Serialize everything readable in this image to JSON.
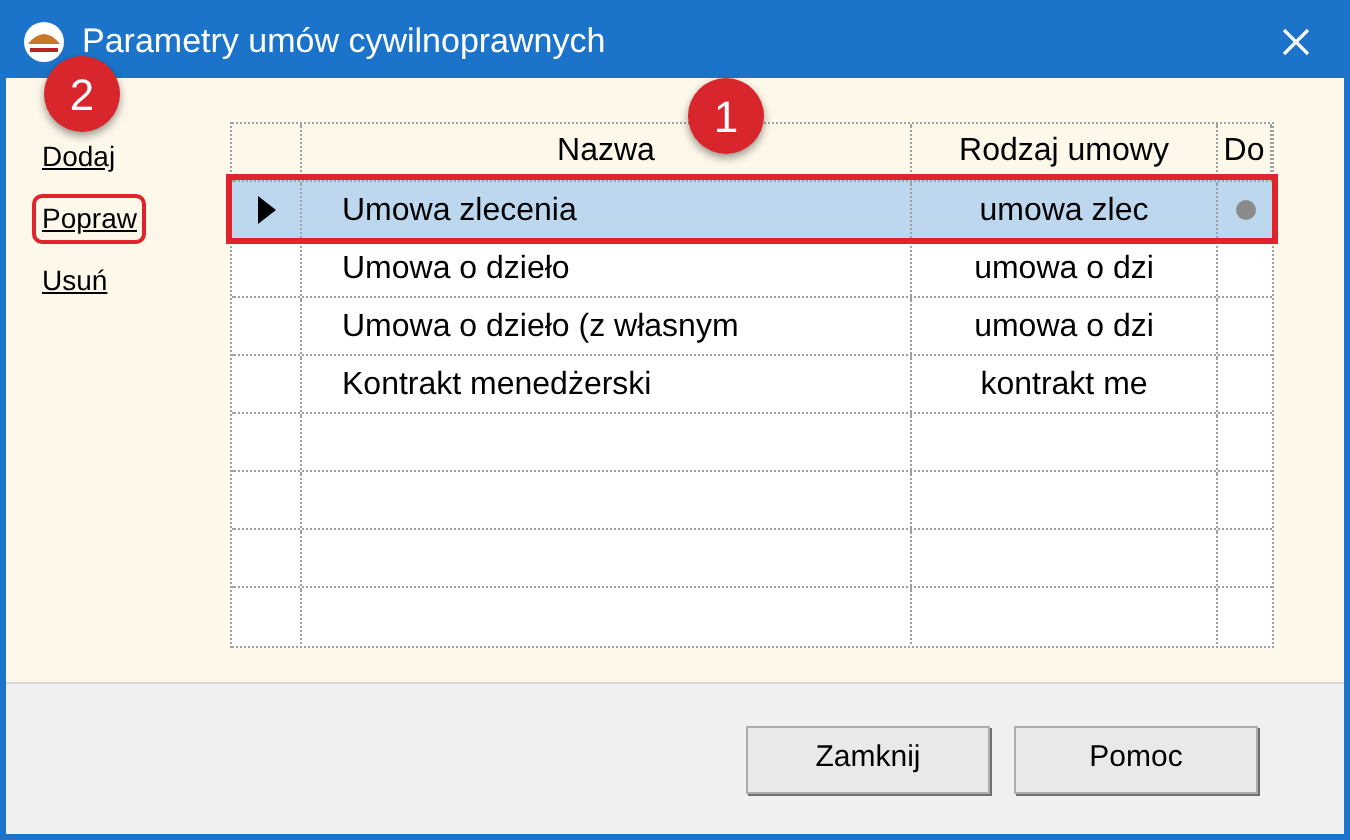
{
  "window": {
    "title": "Parametry umów cywilnoprawnych"
  },
  "actions": [
    {
      "label": "Dodaj",
      "highlighted": false
    },
    {
      "label": "Popraw",
      "highlighted": true
    },
    {
      "label": "Usuń",
      "highlighted": false
    }
  ],
  "table": {
    "columns": [
      "Nazwa",
      "Rodzaj umowy",
      "Do"
    ],
    "rows": [
      {
        "name": "Umowa zlecenia",
        "type": "umowa zlec",
        "marked": true,
        "selected": true,
        "highlighted": true
      },
      {
        "name": "Umowa o dzieło",
        "type": "umowa o dzi",
        "marked": false,
        "selected": false,
        "highlighted": false
      },
      {
        "name": "Umowa o dzieło (z własnym",
        "type": "umowa o dzi",
        "marked": false,
        "selected": false,
        "highlighted": false
      },
      {
        "name": "Kontrakt menedżerski",
        "type": "kontrakt me",
        "marked": false,
        "selected": false,
        "highlighted": false
      }
    ]
  },
  "annotations": [
    {
      "label": "2"
    },
    {
      "label": "1"
    }
  ],
  "buttons": [
    "Zamknij",
    "Pomoc"
  ]
}
